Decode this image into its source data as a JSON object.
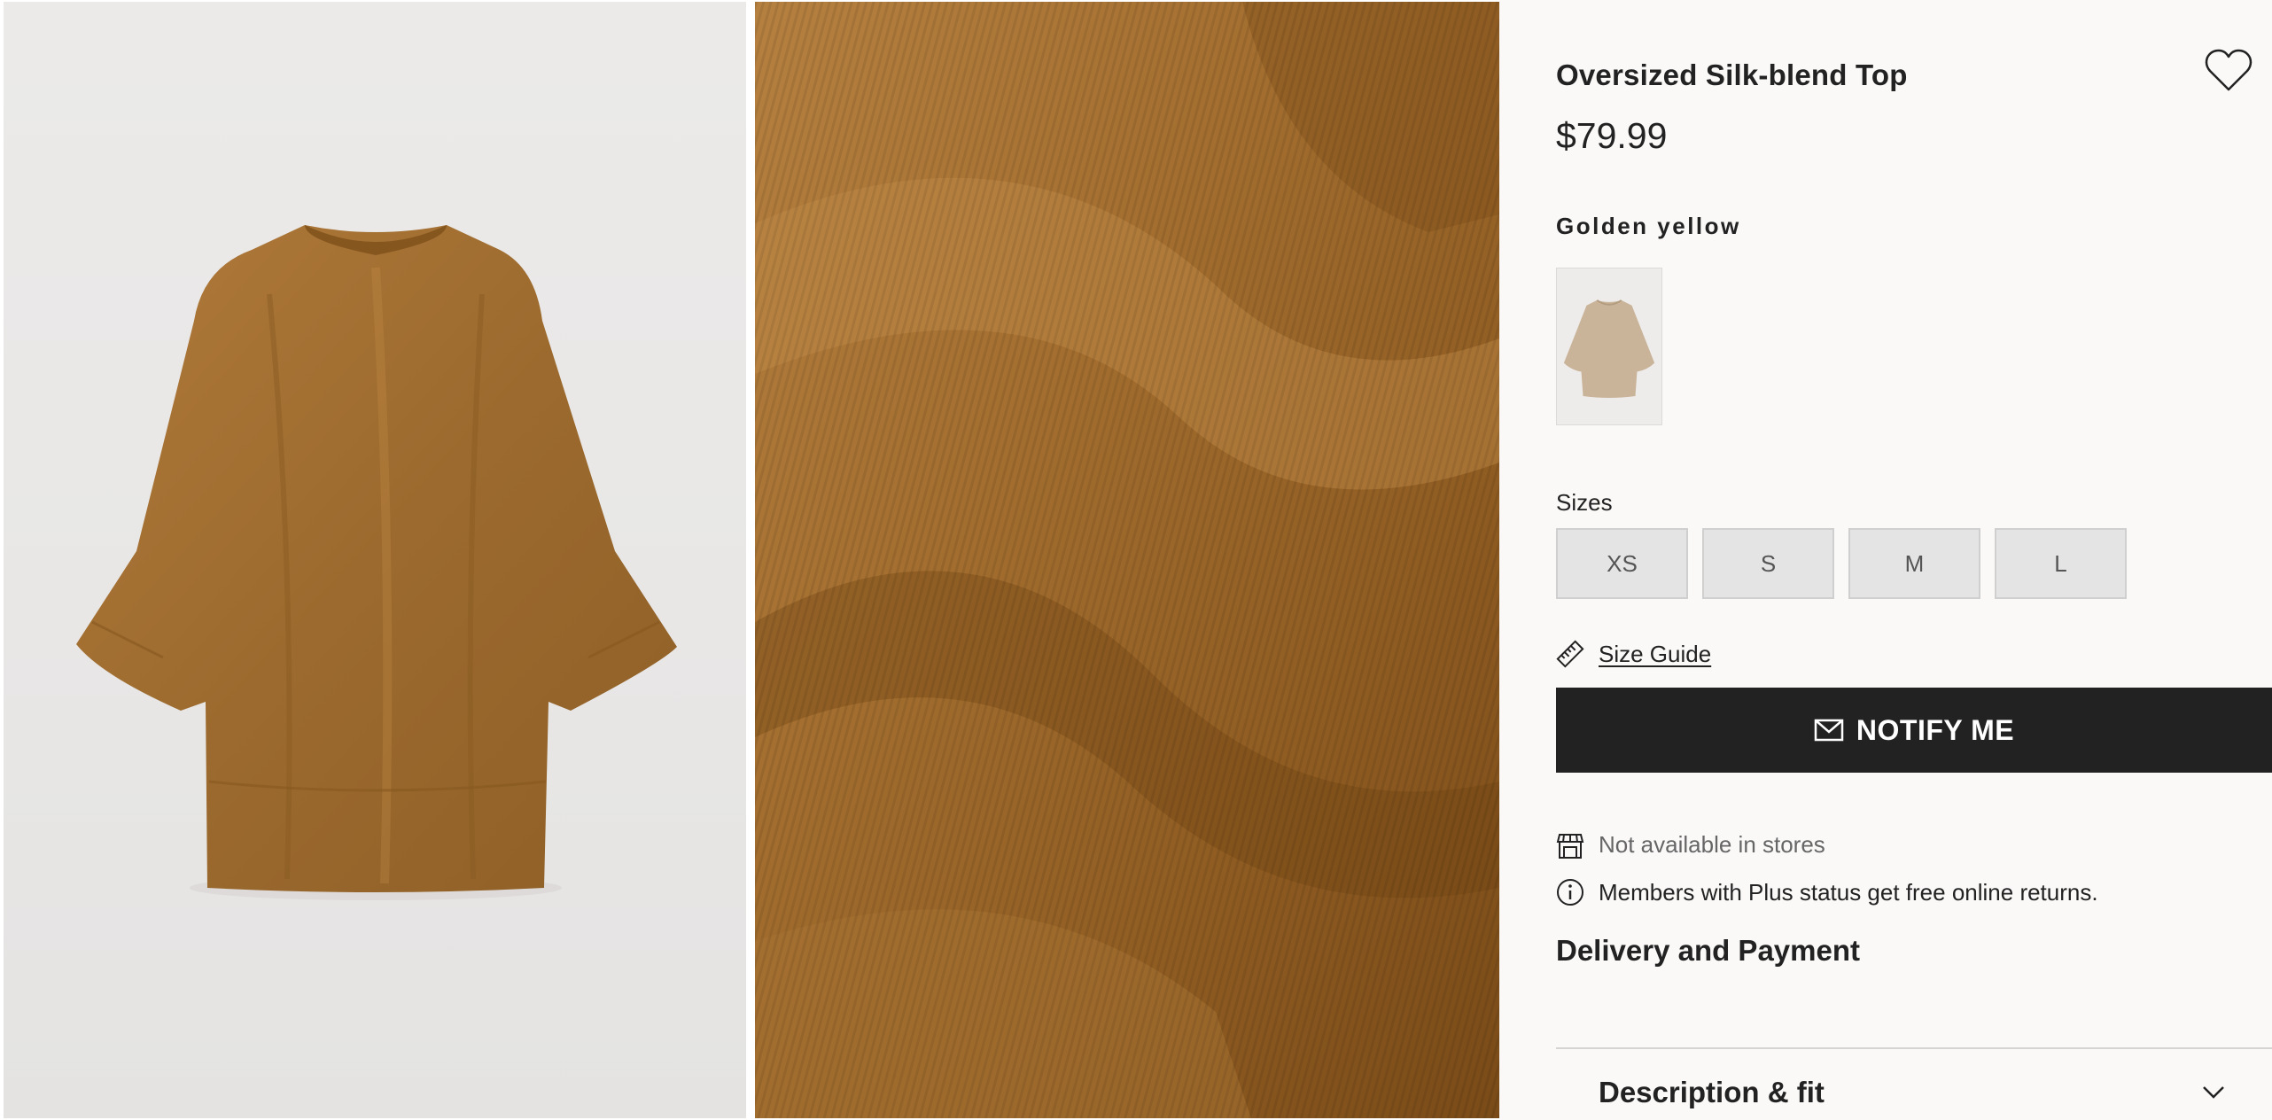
{
  "product": {
    "title": "Oversized Silk-blend Top",
    "price": "$79.99",
    "color_name": "Golden yellow",
    "color_swatch_hex": "#c9b49a",
    "main_color_hex": "#a26f33"
  },
  "gallery": {
    "images": [
      {
        "name": "product-front-photo"
      },
      {
        "name": "fabric-detail-photo"
      }
    ]
  },
  "sizes": {
    "label": "Sizes",
    "options": [
      "XS",
      "S",
      "M",
      "L"
    ]
  },
  "size_guide": {
    "label": "Size Guide",
    "icon": "ruler-icon"
  },
  "notify": {
    "label": "NOTIFY ME",
    "icon": "envelope-icon",
    "bg": "#222222"
  },
  "availability": {
    "stores_text": "Not available in stores",
    "icon": "store-icon"
  },
  "members": {
    "text": "Members with Plus status get free online returns.",
    "icon": "info-icon"
  },
  "delivery": {
    "label": "Delivery and Payment"
  },
  "description": {
    "label": "Description & fit",
    "icon": "chevron-down-icon"
  },
  "favorite": {
    "icon": "heart-icon"
  }
}
